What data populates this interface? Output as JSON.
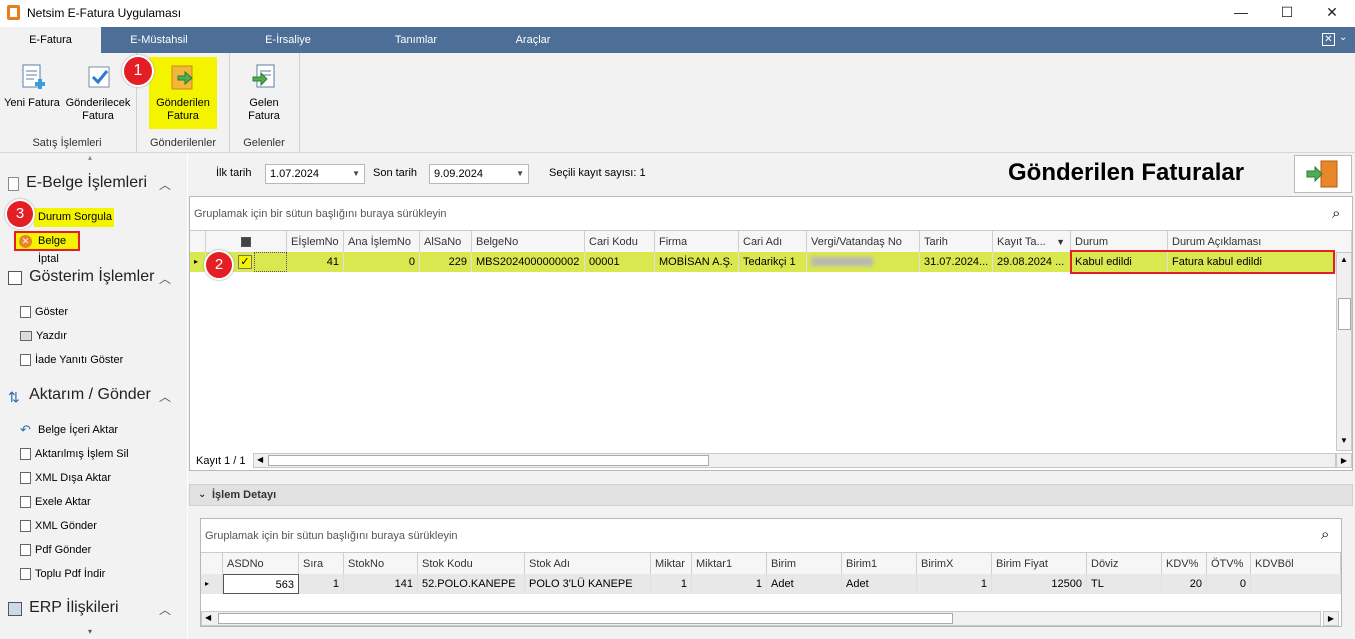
{
  "window": {
    "title": "Netsim E-Fatura Uygulaması",
    "minimize": "—",
    "maximize": "☐",
    "close": "✕"
  },
  "ribbon_tabs": [
    "E-Fatura",
    "E-Müstahsil",
    "E-İrsaliye",
    "Tanımlar",
    "Araçlar"
  ],
  "ribbon": {
    "yeni_fatura": "Yeni Fatura",
    "gonderilecek_1": "Gönderilecek",
    "gonderilecek_2": "Fatura",
    "gonderilen_1": "Gönderilen",
    "gonderilen_2": "Fatura",
    "gelen_1": "Gelen",
    "gelen_2": "Fatura",
    "group_satis": "Satış İşlemleri",
    "group_gonderilenler": "Gönderilenler",
    "group_gelenler": "Gelenler"
  },
  "badges": {
    "b1": "1",
    "b2": "2",
    "b3": "3"
  },
  "side": {
    "ebelge_title": "E-Belge İşlemleri",
    "durum_sorgula": "Durum Sorgula",
    "belge_iptal": "Belge İptal",
    "gosterim_title": "Gösterim İşlemler",
    "goster": "Göster",
    "yazdir": "Yazdır",
    "iade": "İade Yanıtı Göster",
    "aktarim_title": "Aktarım / Gönder",
    "belge_iceri": "Belge İçeri Aktar",
    "aktarilmis_sil": "Aktarılmış İşlem Sil",
    "xml_disa": "XML Dışa Aktar",
    "exele": "Exele Aktar",
    "xml_gonder": "XML Gönder",
    "pdf_gonder": "Pdf Gönder",
    "toplu_pdf": "Toplu Pdf İndir",
    "erp_title": "ERP İlişkileri"
  },
  "filter": {
    "ilk_label": "İlk tarih",
    "ilk_value": "1.07.2024",
    "son_label": "Son tarih",
    "son_value": "9.09.2024",
    "secili_label": "Seçili kayıt sayısı: 1"
  },
  "page_title": "Gönderilen Faturalar",
  "top_grid": {
    "group_hint": "Gruplamak için bir sütun başlığını buraya sürükleyin",
    "headers": [
      "EİşlemNo",
      "Ana İşlemNo",
      "AlSaNo",
      "BelgeNo",
      "Cari Kodu",
      "Firma",
      "Cari Adı",
      "Vergi/Vatandaş No",
      "Tarih",
      "Kayıt Ta...",
      "Durum",
      "Durum Açıklaması"
    ],
    "row": [
      "41",
      "0",
      "229",
      "MBS2024000000002",
      "00001",
      "MOBİSAN A.Ş.",
      "Tedarikçi 1",
      "",
      "31.07.2024...",
      "29.08.2024 ...",
      "Kabul edildi",
      "Fatura kabul edildi"
    ],
    "footer": "Kayıt 1 / 1"
  },
  "detail": {
    "title": "İşlem Detayı",
    "group_hint": "Gruplamak için bir sütun başlığını buraya sürükleyin",
    "headers": [
      "ASDNo",
      "Sıra",
      "StokNo",
      "Stok Kodu",
      "Stok Adı",
      "Miktar",
      "Miktar1",
      "Birim",
      "Birim1",
      "BirimX",
      "Birim Fiyat",
      "Döviz",
      "KDV%",
      "ÖTV%",
      "KDVBöl"
    ],
    "row": [
      "563",
      "1",
      "141",
      "52.POLO.KANEPE",
      "POLO 3'LÜ KANEPE",
      "1",
      "1",
      "Adet",
      "Adet",
      "1",
      "12500",
      "TL",
      "20",
      "0",
      ""
    ]
  },
  "colors": {
    "accent": "#4d6e96",
    "highlight": "#f5f400",
    "row_highlight": "#d9e84f",
    "badge": "#e31e24"
  }
}
